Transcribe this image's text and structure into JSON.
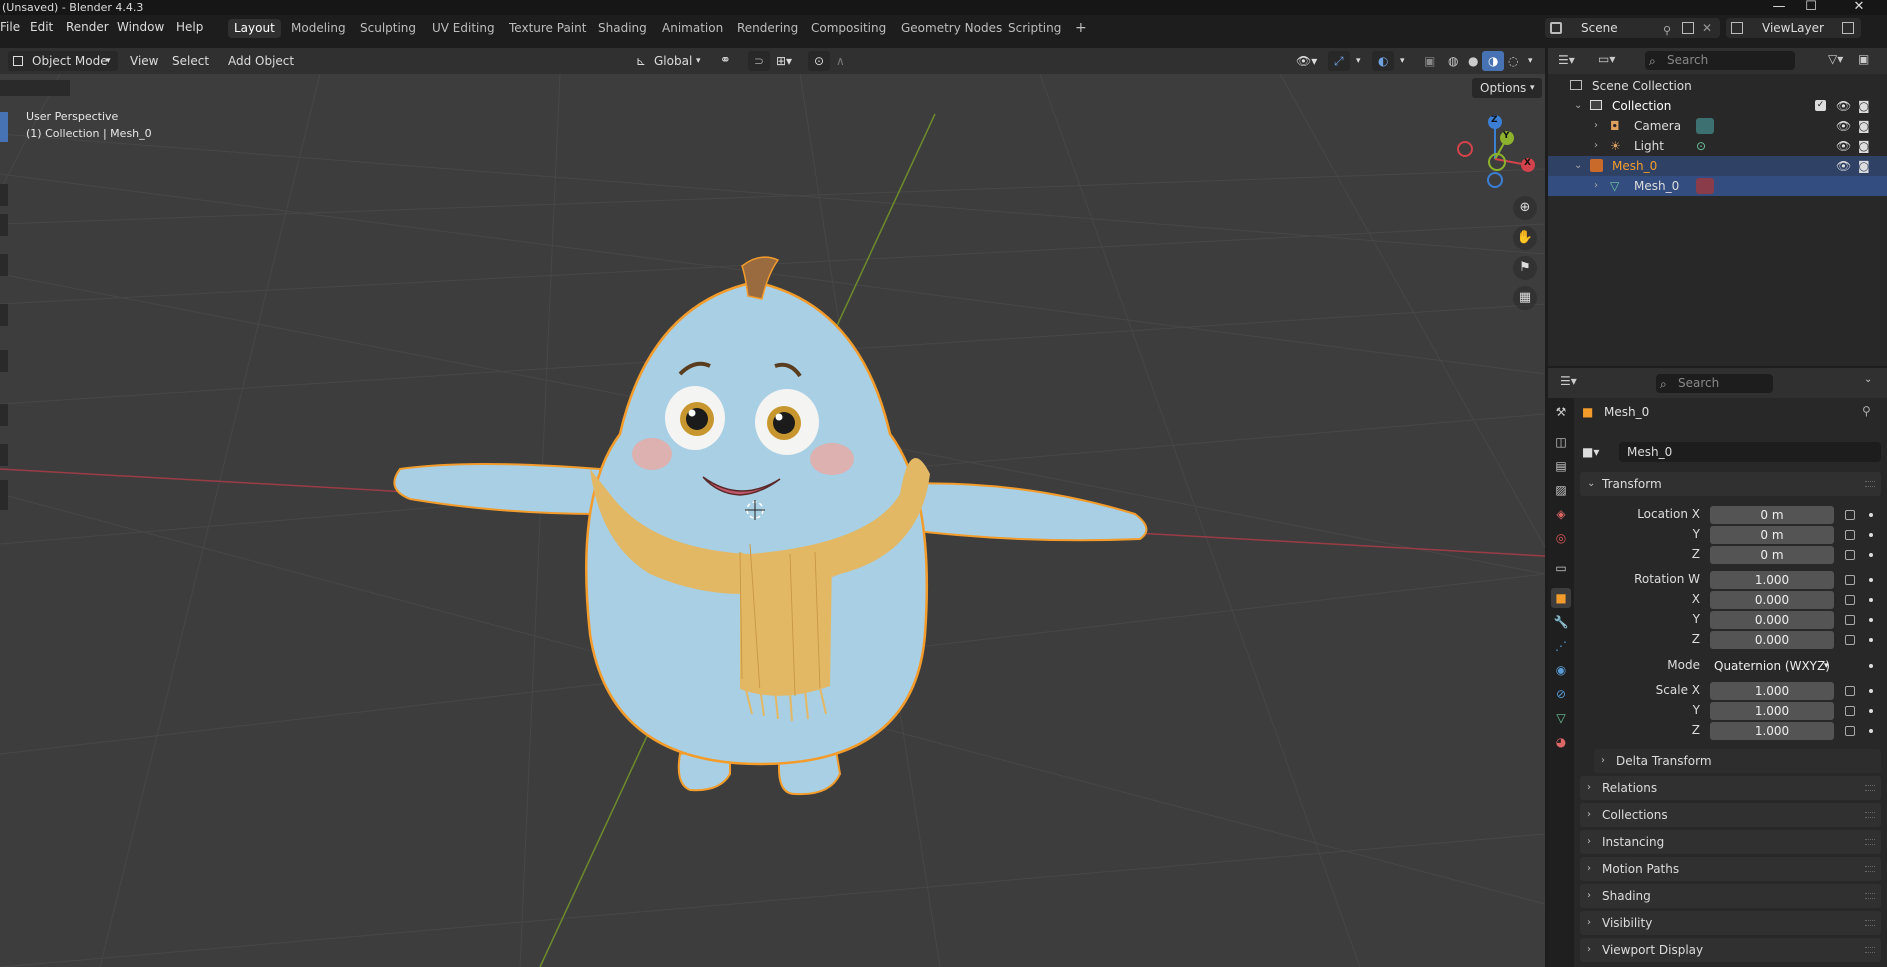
{
  "window": {
    "title": "(Unsaved) - Blender 4.4.3",
    "minimize": "—",
    "maximize": "☐",
    "close": "✕"
  },
  "menu": {
    "file": "File",
    "edit": "Edit",
    "render": "Render",
    "window": "Window",
    "help": "Help"
  },
  "workspaces": [
    "Layout",
    "Modeling",
    "Sculpting",
    "UV Editing",
    "Texture Paint",
    "Shading",
    "Animation",
    "Rendering",
    "Compositing",
    "Geometry Nodes",
    "Scripting"
  ],
  "workspace_add": "+",
  "scene": {
    "name": "Scene",
    "viewlayer": "ViewLayer"
  },
  "viewport_header": {
    "mode": "Object Mode",
    "view": "View",
    "select": "Select",
    "add": "Add",
    "object": "Object",
    "orientation": "Global",
    "options": "Options"
  },
  "overlay": {
    "perspective": "User Perspective",
    "collection_info": "(1) Collection | Mesh_0"
  },
  "gizmo": {
    "z": "Z",
    "y": "Y",
    "x": "X"
  },
  "outliner": {
    "search_placeholder": "Search",
    "scene_collection": "Scene Collection",
    "collection": "Collection",
    "camera": "Camera",
    "light": "Light",
    "mesh_obj": "Mesh_0",
    "mesh_data": "Mesh_0"
  },
  "properties": {
    "search_placeholder": "Search",
    "object_name": "Mesh_0",
    "object_name_field": "Mesh_0",
    "transform": "Transform",
    "location_x_label": "Location X",
    "location_x": "0 m",
    "y_label": "Y",
    "location_y": "0 m",
    "z_label": "Z",
    "location_z": "0 m",
    "rotation_w_label": "Rotation W",
    "rotation_w": "1.000",
    "x_label": "X",
    "rotation_x": "0.000",
    "rotation_y": "0.000",
    "rotation_z": "0.000",
    "mode_label": "Mode",
    "mode_value": "Quaternion (WXYZ)",
    "scale_x_label": "Scale X",
    "scale_x": "1.000",
    "scale_y": "1.000",
    "scale_z": "1.000",
    "delta_transform": "Delta Transform",
    "panels": [
      "Relations",
      "Collections",
      "Instancing",
      "Motion Paths",
      "Shading",
      "Visibility",
      "Viewport Display"
    ]
  },
  "colors": {
    "accent": "#4772b3",
    "selection_outline": "#f39c2b",
    "character_body": "#a8cfe3",
    "scarf": "#e3b865",
    "x_axis": "#c0404b",
    "y_axis": "#7a9a2d"
  }
}
